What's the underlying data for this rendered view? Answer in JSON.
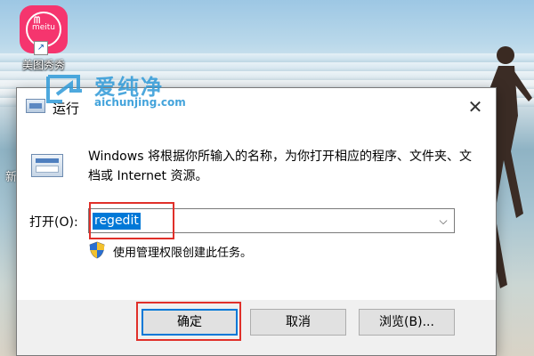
{
  "desktop": {
    "shortcut_label": "美图秀秀",
    "shortcut_logo_text": "meitu",
    "left_edge_label": "新"
  },
  "watermark": {
    "cn": "爱纯净",
    "en": "aichunjing.com"
  },
  "dialog": {
    "title": "运行",
    "close_glyph": "✕",
    "description": "Windows 将根据你所输入的名称，为你打开相应的程序、文件夹、文档或 Internet 资源。",
    "open_label": "打开(O):",
    "command_value": "regedit",
    "admin_note": "使用管理权限创建此任务。",
    "buttons": {
      "ok": "确定",
      "cancel": "取消",
      "browse": "浏览(B)..."
    }
  },
  "colors": {
    "selection": "#0078d7",
    "highlight_box": "#e0302a",
    "meitu_brand": "#f5356e"
  }
}
